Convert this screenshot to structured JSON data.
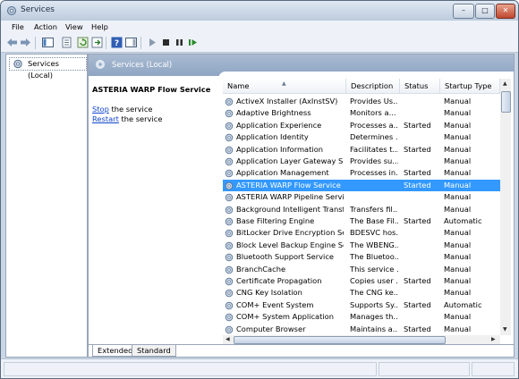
{
  "window": {
    "title": "Services"
  },
  "menu": [
    "File",
    "Action",
    "View",
    "Help"
  ],
  "tree": {
    "root_label": "Services (Local)"
  },
  "header": {
    "title": "Services (Local)"
  },
  "details": {
    "service_name": "ASTERIA WARP Flow Service",
    "stop_link": "Stop",
    "stop_rest": " the service",
    "restart_link": "Restart",
    "restart_rest": " the service"
  },
  "columns": {
    "name": "Name",
    "description": "Description",
    "status": "Status",
    "startup": "Startup Type"
  },
  "services": [
    {
      "name": "ActiveX Installer (AxInstSV)",
      "description": "Provides Us...",
      "status": "",
      "startup": "Manual"
    },
    {
      "name": "Adaptive Brightness",
      "description": "Monitors a...",
      "status": "",
      "startup": "Manual"
    },
    {
      "name": "Application Experience",
      "description": "Processes a...",
      "status": "Started",
      "startup": "Manual"
    },
    {
      "name": "Application Identity",
      "description": "Determines ...",
      "status": "",
      "startup": "Manual"
    },
    {
      "name": "Application Information",
      "description": "Facilitates t...",
      "status": "Started",
      "startup": "Manual"
    },
    {
      "name": "Application Layer Gateway Ser...",
      "description": "Provides su...",
      "status": "",
      "startup": "Manual"
    },
    {
      "name": "Application Management",
      "description": "Processes in...",
      "status": "Started",
      "startup": "Manual"
    },
    {
      "name": "ASTERIA WARP Flow Service",
      "description": "",
      "status": "Started",
      "startup": "Manual",
      "selected": true
    },
    {
      "name": "ASTERIA WARP Pipeline Service",
      "description": "",
      "status": "",
      "startup": "Manual"
    },
    {
      "name": "Background Intelligent Transfe...",
      "description": "Transfers fil...",
      "status": "",
      "startup": "Manual"
    },
    {
      "name": "Base Filtering Engine",
      "description": "The Base Fil...",
      "status": "Started",
      "startup": "Automatic"
    },
    {
      "name": "BitLocker Drive Encryption Ser...",
      "description": "BDESVC hos...",
      "status": "",
      "startup": "Manual"
    },
    {
      "name": "Block Level Backup Engine Ser...",
      "description": "The WBENG...",
      "status": "",
      "startup": "Manual"
    },
    {
      "name": "Bluetooth Support Service",
      "description": "The Bluetoo...",
      "status": "",
      "startup": "Manual"
    },
    {
      "name": "BranchCache",
      "description": "This service ...",
      "status": "",
      "startup": "Manual"
    },
    {
      "name": "Certificate Propagation",
      "description": "Copies user ...",
      "status": "Started",
      "startup": "Manual"
    },
    {
      "name": "CNG Key Isolation",
      "description": "The CNG ke...",
      "status": "",
      "startup": "Manual"
    },
    {
      "name": "COM+ Event System",
      "description": "Supports Sy...",
      "status": "Started",
      "startup": "Automatic"
    },
    {
      "name": "COM+ System Application",
      "description": "Manages th...",
      "status": "",
      "startup": "Manual"
    },
    {
      "name": "Computer Browser",
      "description": "Maintains a...",
      "status": "Started",
      "startup": "Manual"
    }
  ],
  "tabs": {
    "extended": "Extended",
    "standard": "Standard"
  },
  "colors": {
    "selection": "#3399ff",
    "link": "#1144cc",
    "header": "#8ea5c2"
  }
}
